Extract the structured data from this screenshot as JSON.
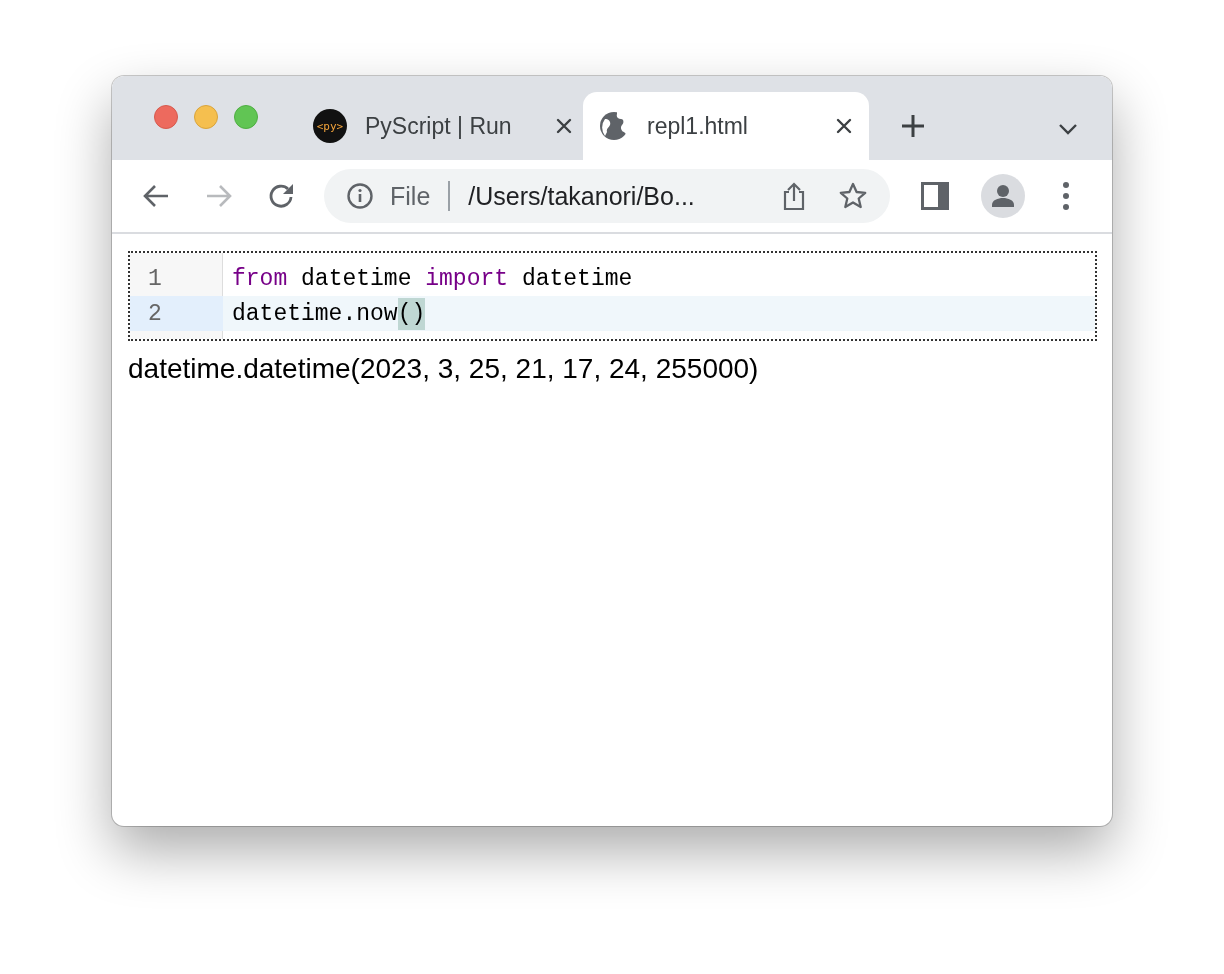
{
  "tabs": [
    {
      "label": "PyScript | Run",
      "selected": false,
      "kind": "logo",
      "favicon_text": "<py>"
    },
    {
      "label": "repl1.html",
      "selected": true,
      "kind": "globe"
    }
  ],
  "address": {
    "scheme_label": "File",
    "url": "/Users/takanori/Bo..."
  },
  "editor": {
    "lines": [
      {
        "number": "1",
        "active": false,
        "tokens": [
          {
            "text": "from",
            "kind": "keyword"
          },
          {
            "text": " datetime ",
            "kind": "plain"
          },
          {
            "text": "import",
            "kind": "keyword"
          },
          {
            "text": " datetime",
            "kind": "plain"
          }
        ]
      },
      {
        "number": "2",
        "active": true,
        "tokens": [
          {
            "text": "datetime.now",
            "kind": "plain"
          },
          {
            "text": "()",
            "kind": "match"
          }
        ]
      }
    ]
  },
  "output": "datetime.datetime(2023, 3, 25, 21, 17, 24, 255000)"
}
